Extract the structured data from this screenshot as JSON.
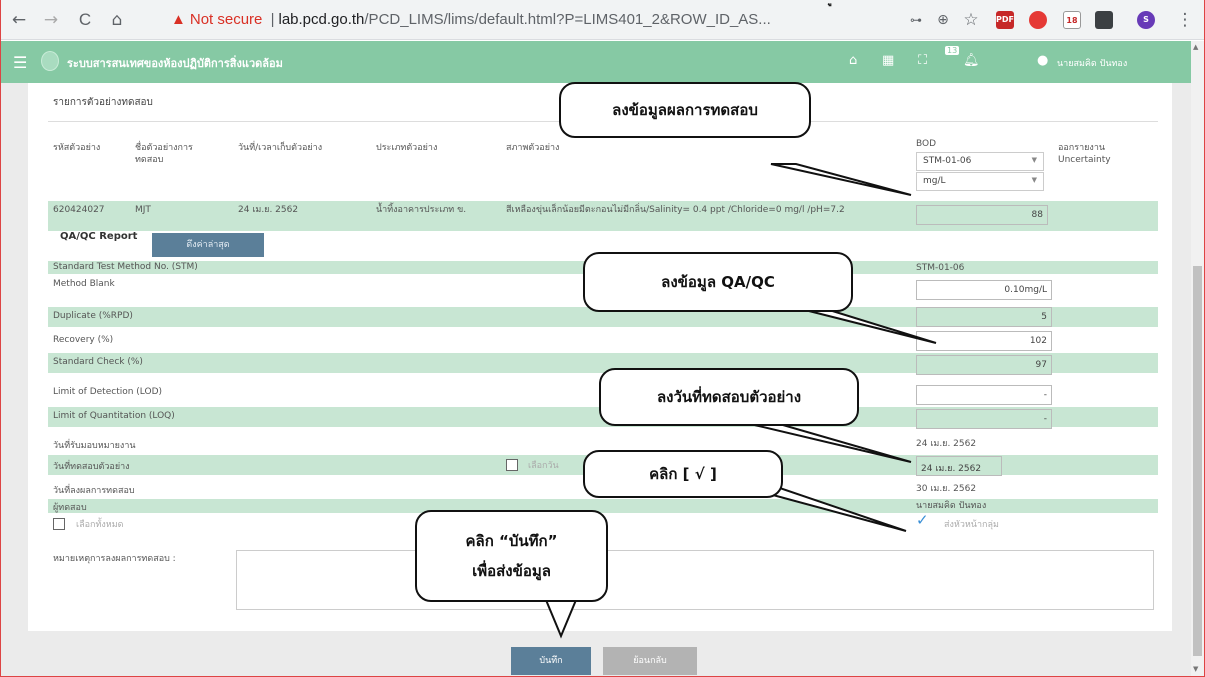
{
  "browser": {
    "back": "←",
    "forward": "→",
    "reload": "C",
    "home": "⌂",
    "not_secure": "Not secure",
    "separator": "|",
    "url_host": "lab.pcd.go.th",
    "url_path": "/PCD_LIMS/lims/default.html?P=LIMS401_2&ROW_ID_AS...",
    "ext_pdf": "PDF",
    "ext_cal": "18",
    "profile": "S",
    "menu": "⋮"
  },
  "app": {
    "title": "ระบบสารสนเทศของห้องปฏิบัติการสิ่งแวดล้อม",
    "badge": "13",
    "user": "นายสมคิด ปันทอง",
    "header_accent": "#86c9a4"
  },
  "panel": {
    "title": "รายการตัวอย่างทดสอบ",
    "columns": [
      "รหัสตัวอย่าง",
      "ชื่อตัวอย่างการทดสอบ",
      "วันที่/เวลาเก็บตัวอย่าง",
      "ประเภทตัวอย่าง",
      "สภาพตัวอย่าง",
      "BOD",
      "ออกรายงาน Uncertainty"
    ],
    "bod_stm": "STM-01-06",
    "bod_unit": "mg/L",
    "sample": {
      "id": "620424027",
      "name": "MJT",
      "date": "24 เม.ย. 2562",
      "type": "น้ำทิ้งอาคารประเภท ข.",
      "condition": "สีเหลืองขุ่นเล็กน้อยมีตะกอนไม่มีกลิ่น/Salinity= 0.4 ppt /Chloride=0 mg/l /pH=7.2",
      "bod_value": "88"
    }
  },
  "qa": {
    "tab_label": "QA/QC Report",
    "latest_button": "ดึงค่าล่าสุด",
    "rows": [
      {
        "label": "Standard Test Method No. (STM)",
        "value": "STM-01-06"
      },
      {
        "label": "Method Blank",
        "value": "0.10mg/L"
      },
      {
        "label": "Duplicate (%RPD)",
        "value": "5"
      },
      {
        "label": "Recovery (%)",
        "value": "102"
      },
      {
        "label": "Standard Check (%)",
        "value": "97"
      },
      {
        "label": "Limit of Detection (LOD)",
        "value": "-"
      },
      {
        "label": "Limit of Quantitation (LOQ)",
        "value": "-"
      },
      {
        "label": "วันที่รับมอบหมายงาน",
        "value": "24 เม.ย. 2562"
      },
      {
        "label": "วันที่ทดสอบตัวอย่าง",
        "value": "24 เม.ย. 2562"
      },
      {
        "label": "วันที่ลงผลการทดสอบ",
        "value": "30 เม.ย. 2562"
      },
      {
        "label": "ผู้ทดสอบ",
        "value": "นายสมคิด ปันทอง"
      }
    ],
    "select_date_label": "เลือกวัน",
    "select_all_label": "เลือกทั้งหมด",
    "send_label": "ส่งหัวหน้ากลุ่ม",
    "remark_label": "หมายเหตุการลงผลการทดสอบ :"
  },
  "actions": {
    "save": "บันทึก",
    "back": "ย้อนกลับ"
  },
  "callouts": {
    "result": "ลงข้อมูลผลการทดสอบ",
    "qaqc": "ลงข้อมูล  QA/QC",
    "test_date": "ลงวันที่ทดสอบตัวอย่าง",
    "check": "คลิก [ √ ]",
    "save_line1": "คลิก “บันทึก”",
    "save_line2": "เพื่อส่งข้อมูล",
    "top_mark": "ู"
  }
}
